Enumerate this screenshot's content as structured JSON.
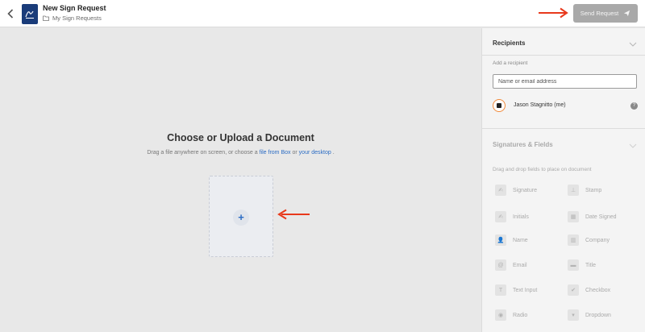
{
  "header": {
    "title": "New Sign Request",
    "breadcrumb": "My Sign Requests",
    "send_label": "Send Request"
  },
  "main": {
    "heading": "Choose or Upload a Document",
    "sub_prefix": "Drag a file anywhere on screen, or choose a",
    "sub_link1": "file from Box",
    "sub_middle": "or",
    "sub_link2": "your desktop",
    "sub_suffix": ".",
    "plus_label": "+"
  },
  "recipients": {
    "title": "Recipients",
    "add_label": "Add a recipient",
    "input_placeholder": "Name or email address",
    "list": [
      {
        "name": "Jason Stagnitto (me)",
        "help": "?"
      }
    ]
  },
  "fields_section": {
    "title": "Signatures & Fields",
    "hint": "Drag and drop fields to place on document",
    "left": [
      {
        "label": "Signature",
        "icon": "signature-icon",
        "glyph": "✍"
      },
      {
        "label": "Initials",
        "icon": "initials-icon",
        "glyph": "✍"
      },
      {
        "label": "Name",
        "icon": "person-icon",
        "glyph": "👤"
      },
      {
        "label": "Email",
        "icon": "at-icon",
        "glyph": "@"
      },
      {
        "label": "Text Input",
        "icon": "text-input-icon",
        "glyph": "T"
      },
      {
        "label": "Radio",
        "icon": "radio-icon",
        "glyph": "◉"
      }
    ],
    "right": [
      {
        "label": "Stamp",
        "icon": "stamp-icon",
        "glyph": "⊥"
      },
      {
        "label": "Date Signed",
        "icon": "calendar-icon",
        "glyph": "▦"
      },
      {
        "label": "Company",
        "icon": "building-icon",
        "glyph": "▥"
      },
      {
        "label": "Title",
        "icon": "id-card-icon",
        "glyph": "▬"
      },
      {
        "label": "Checkbox",
        "icon": "checkbox-icon",
        "glyph": "✔"
      },
      {
        "label": "Dropdown",
        "icon": "dropdown-icon",
        "glyph": "▾"
      }
    ]
  },
  "colors": {
    "annotation_arrow": "#e8391c",
    "link": "#2b6cc4",
    "app_icon": "#1a3c7a",
    "avatar_ring": "#f08a3c"
  }
}
